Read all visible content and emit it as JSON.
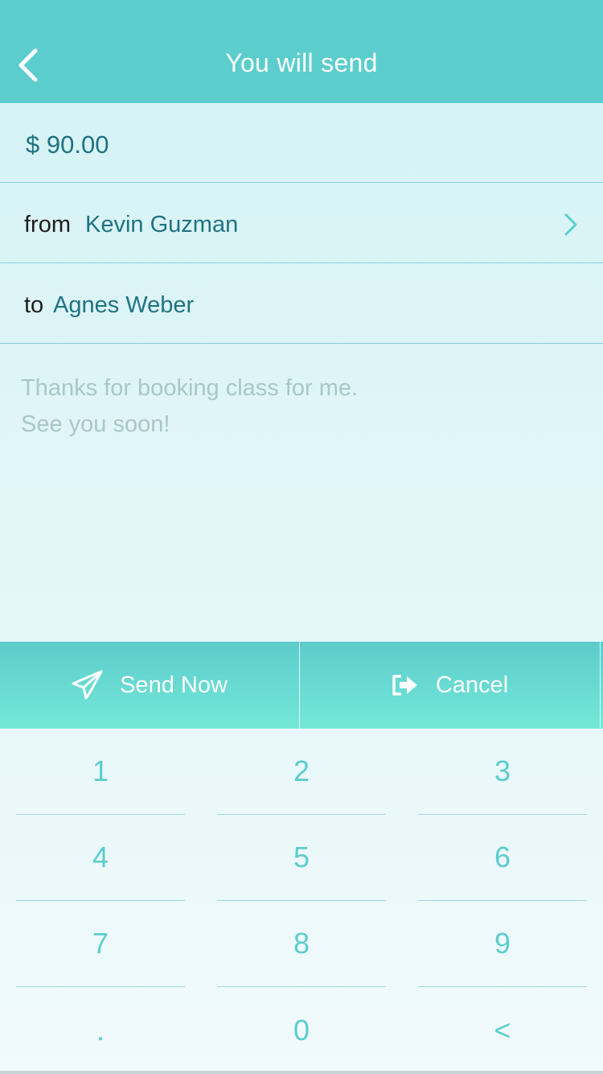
{
  "header": {
    "title": "You will send"
  },
  "amount": {
    "text": "$ 90.00"
  },
  "from": {
    "label": "from",
    "name": "Kevin Guzman"
  },
  "to": {
    "label": "to",
    "name": "Agnes Weber"
  },
  "message": {
    "line1": "Thanks for booking class for me.",
    "line2": "See you soon!"
  },
  "actions": {
    "send_label": "Send Now",
    "cancel_label": "Cancel"
  },
  "keypad": {
    "k1": "1",
    "k2": "2",
    "k3": "3",
    "k4": "4",
    "k5": "5",
    "k6": "6",
    "k7": "7",
    "k8": "8",
    "k9": "9",
    "dot": ".",
    "k0": "0",
    "back": "<"
  },
  "colors": {
    "accent": "#5ccdcd",
    "name_text": "#1f7383",
    "placeholder": "#a9c6c8"
  },
  "icons": {
    "back": "chevron-left-icon",
    "from_chevron": "chevron-right-icon",
    "send": "paper-plane-icon",
    "cancel": "exit-icon"
  }
}
